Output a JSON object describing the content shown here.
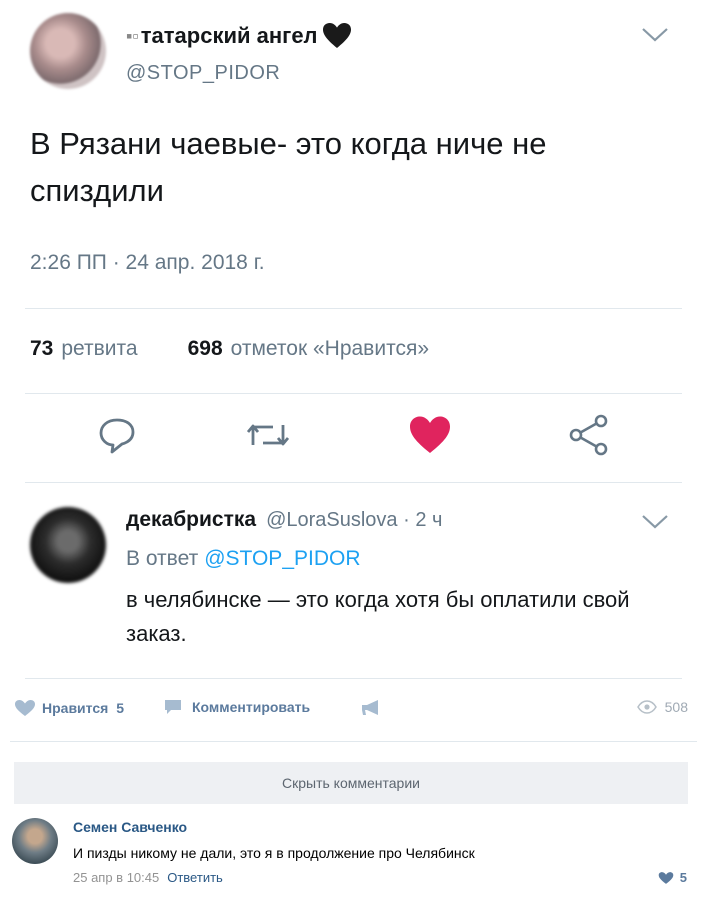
{
  "tweet": {
    "display_name_prefix": "▪▫",
    "display_name": "татарский ангел",
    "handle": "@STOP_PIDOR",
    "text": "В Рязани чаевые- это когда ниче не спиздили",
    "timestamp": "2:26 ПП · 24 апр. 2018 г.",
    "retweets_count": "73",
    "retweets_label": "ретвита",
    "likes_count": "698",
    "likes_label": "отметок «Нравится»",
    "colors": {
      "like_red": "#e0245e",
      "icon_gray": "#657786",
      "link_blue": "#1da1f2"
    }
  },
  "reply": {
    "name": "декабристка",
    "handle": "@LoraSuslova · 2 ч",
    "reply_to_label": "В ответ",
    "reply_to_handle": "@STOP_PIDOR",
    "text": "в челябинске — это когда хотя бы оплатили свой заказ."
  },
  "vk": {
    "like_label": "Нравится",
    "like_count": "5",
    "comment_label": "Комментировать",
    "views": "508",
    "hide_comments_label": "Скрыть комментарии",
    "comment": {
      "author": "Семен Савченко",
      "text": "И пизды никому не дали, это я в продолжение про Челябинск",
      "date": "25 апр в 10:45",
      "reply_label": "Ответить",
      "likes": "5"
    }
  }
}
